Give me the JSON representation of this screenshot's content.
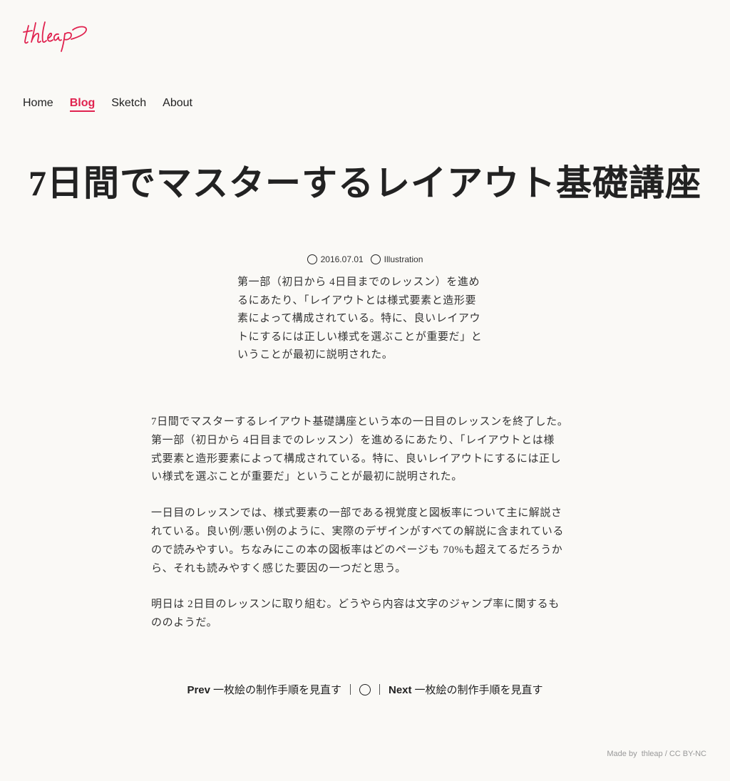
{
  "brand": {
    "logo_text": "thleap",
    "accent": "#e0224f"
  },
  "nav": {
    "items": [
      {
        "label": "Home",
        "active": false
      },
      {
        "label": "Blog",
        "active": true
      },
      {
        "label": "Sketch",
        "active": false
      },
      {
        "label": "About",
        "active": false
      }
    ]
  },
  "post": {
    "title": "7日間でマスターするレイアウト基礎講座",
    "date": "2016.07.01",
    "category": "Illustration",
    "excerpt_lines": [
      "第一部（初日から 4日目までのレッスン）を進め",
      "るにあたり、「レイアウトとは様式要素と造形要",
      "素によって構成されている。特に、良いレイアウ",
      "トにするには正しい様式を選ぶことが重要だ」と",
      "いうことが最初に説明された。"
    ],
    "paragraphs": [
      [
        "7日間でマスターするレイアウト基礎講座という本の一日目のレッスンを終了した。",
        "第一部（初日から 4日目までのレッスン）を進めるにあたり、「レイアウトとは様",
        "式要素と造形要素によって構成されている。特に、良いレイアウトにするには正し",
        "い様式を選ぶことが重要だ」ということが最初に説明された。"
      ],
      [
        "一日目のレッスンでは、様式要素の一部である視覚度と図板率について主に解説さ",
        "れている。良い例/悪い例のように、実際のデザインがすべての解説に含まれている",
        "ので読みやすい。ちなみにこの本の図板率はどのページも 70%も超えてるだろうか",
        "ら、それも読みやすく感じた要因の一つだと思う。"
      ],
      [
        "明日は 2日目のレッスンに取り組む。どうやら内容は文字のジャンプ率に関するも",
        "ののようだ。"
      ]
    ]
  },
  "pager": {
    "prev_label": "Prev",
    "prev_title": "一枚絵の制作手順を見直す",
    "next_label": "Next",
    "next_title": "一枚絵の制作手順を見直す"
  },
  "footer": {
    "text": "Made by  thleap / CC BY-NC"
  }
}
